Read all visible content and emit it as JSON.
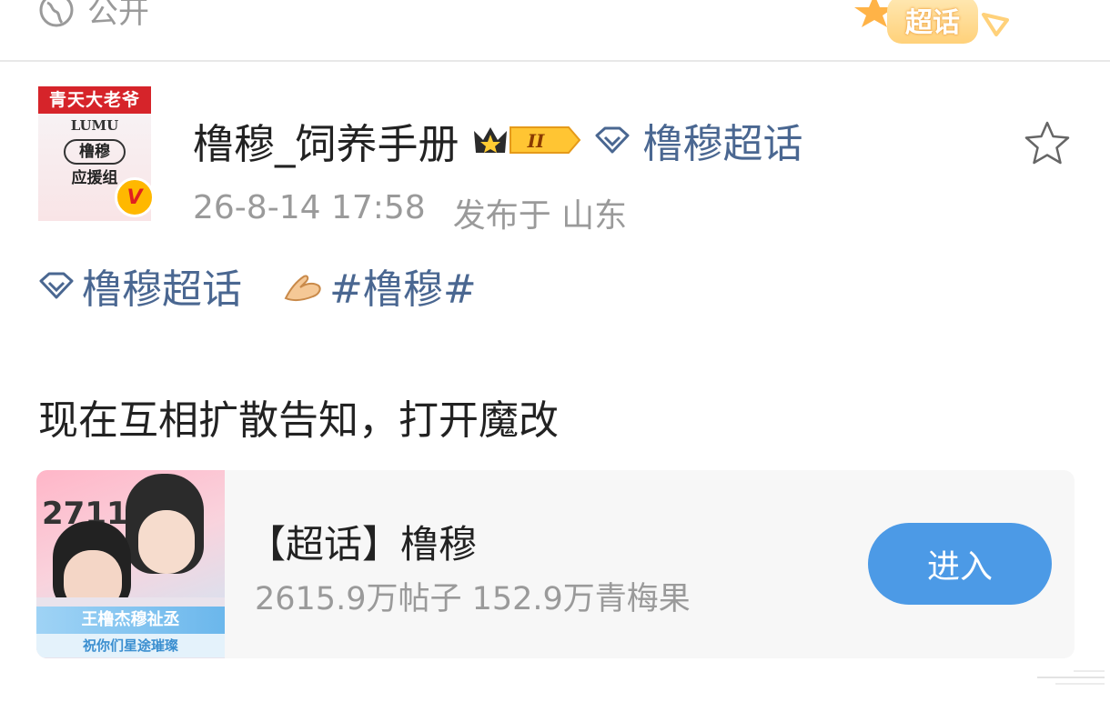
{
  "top": {
    "visibility_label": "公开",
    "supertopic_badge": "超话",
    "icons": [
      "globe-icon",
      "star-burst-icon",
      "play-badge-icon"
    ]
  },
  "post": {
    "avatar": {
      "top_text": "青天大老爷",
      "lumu": "LUMU",
      "name": "橹穆",
      "group": "应援组",
      "v_badge": "V"
    },
    "author": "橹穆_饲养手册",
    "level_badge": "II",
    "supertopic_link": "橹穆超话",
    "timestamp": "26-8-14 17:58",
    "location": "发布于 山东",
    "tags": {
      "supertopic": "橹穆超话",
      "topic": "#橹穆#"
    },
    "body": "现在互相扩散告知，打开魔改"
  },
  "card": {
    "image": {
      "number": "2711",
      "banner": "王橹杰穆祉丞",
      "subtitle": "祝你们星途璀璨"
    },
    "title": "【超话】橹穆",
    "stats": "2615.9万帖子 152.9万青梅果",
    "enter_label": "进入"
  },
  "colors": {
    "link": "#4a6791",
    "muted": "#9a9a9a",
    "button": "#4c9ae6",
    "card_bg": "#f7f7f7"
  }
}
